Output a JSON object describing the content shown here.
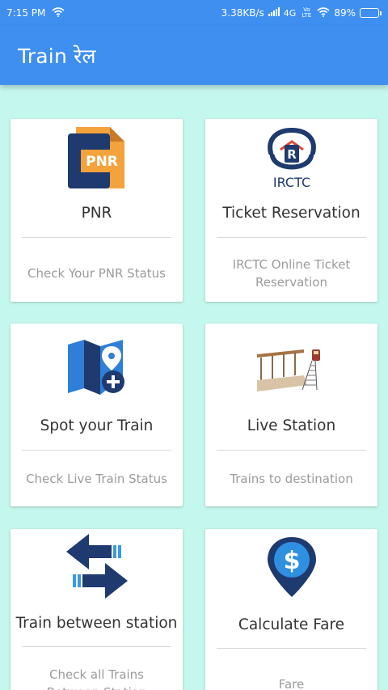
{
  "status_bar": {
    "time": "7:15 PM",
    "speed": "3.38KB/s",
    "network": "4G",
    "volte": "Vo LTE",
    "battery": "89%",
    "battery_level": 0.89,
    "icons": [
      "wifi-icon",
      "signal-icon",
      "wifi-icon",
      "battery-icon"
    ]
  },
  "appbar": {
    "title": "Train रेल"
  },
  "colors": {
    "primary": "#3f8ff1",
    "background": "#c4f7ed",
    "card": "#ffffff"
  },
  "cards": [
    {
      "title": "PNR",
      "subtitle": "Check Your PNR Status",
      "icon": "pnr-icon"
    },
    {
      "title": "Ticket Reservation",
      "subtitle": "IRCTC Online Ticket Reservation",
      "icon": "irctc-logo-icon",
      "logo_text": "IRCTC"
    },
    {
      "title": "Spot your Train",
      "subtitle": "Check Live Train Status",
      "icon": "map-location-icon"
    },
    {
      "title": "Live Station",
      "subtitle": "Trains to destination",
      "icon": "station-platform-icon"
    },
    {
      "title": "Train between station",
      "subtitle": "Check all Trains Between Station",
      "icon": "swap-arrows-icon"
    },
    {
      "title": "Calculate Fare",
      "subtitle": "Fare",
      "icon": "dollar-pin-icon"
    }
  ]
}
